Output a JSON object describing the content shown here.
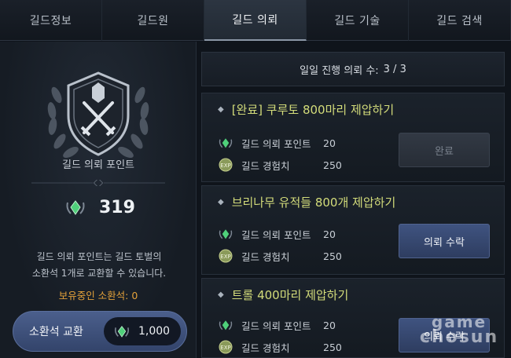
{
  "tabs": [
    {
      "label": "길드정보",
      "active": false
    },
    {
      "label": "길드원",
      "active": false
    },
    {
      "label": "길드 의뢰",
      "active": true
    },
    {
      "label": "길드 기술",
      "active": false
    },
    {
      "label": "길드 검색",
      "active": false
    }
  ],
  "left": {
    "points_title": "길드 의뢰 포인트",
    "points_value": "319",
    "description_line1": "길드 의뢰 포인트는 길드 토벌의",
    "description_line2": "소환석 1개로 교환할 수 있습니다.",
    "owned_label": "보유중인 소환석: 0",
    "exchange_label": "소환석 교환",
    "exchange_cost": "1,000"
  },
  "progress": {
    "label": "일일 진행 의뢰 수:",
    "value": "3 / 3"
  },
  "quests": [
    {
      "title": "[완료] 쿠루토 800마리 제압하기",
      "reward_points_label": "길드 의뢰 포인트",
      "reward_points": "20",
      "reward_exp_label": "길드 경험치",
      "reward_exp": "250",
      "button_label": "완료",
      "state": "done"
    },
    {
      "title": "브리나무 유적들 800개 제압하기",
      "reward_points_label": "길드 의뢰 포인트",
      "reward_points": "20",
      "reward_exp_label": "길드 경험치",
      "reward_exp": "250",
      "button_label": "의뢰 수락",
      "state": "available"
    },
    {
      "title": "트롤 400마리 제압하기",
      "reward_points_label": "길드 의뢰 포인트",
      "reward_points": "20",
      "reward_exp_label": "길드 경험치",
      "reward_exp": "250",
      "button_label": "의뢰 수락",
      "state": "available"
    }
  ],
  "watermark": {
    "line1": "game",
    "line2": "chosun"
  },
  "colors": {
    "accent_title": "#d3dc7a",
    "owned_orange": "#e3a13a",
    "button_blue": "#3f5380",
    "gem_green": "#4fd07a"
  },
  "icons": {
    "points": "guild-point-gem-icon",
    "exp": "exp-coin-icon",
    "emblem": "guild-crest-icon"
  }
}
